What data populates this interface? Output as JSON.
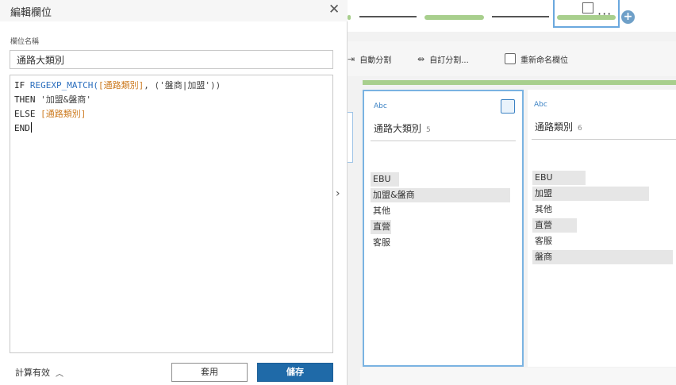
{
  "dialog": {
    "title": "編輯欄位",
    "field_label": "欄位名稱",
    "field_value": "通路大類別",
    "code_lines": [
      [
        {
          "t": "IF ",
          "c": "kw"
        },
        {
          "t": "REGEXP_MATCH(",
          "c": "fn"
        },
        {
          "t": "[通路類別]",
          "c": "fld"
        },
        {
          "t": ", ('盤商|加盟'))",
          "c": "str"
        }
      ],
      [
        {
          "t": "THEN ",
          "c": "kw"
        },
        {
          "t": "'加盟&盤商'",
          "c": "str"
        }
      ],
      [
        {
          "t": "ELSE ",
          "c": "kw"
        },
        {
          "t": "[通路類別]",
          "c": "fld"
        }
      ],
      [
        {
          "t": "END",
          "c": "kw"
        }
      ]
    ],
    "status": "計算有效",
    "apply_label": "套用",
    "save_label": "儲存"
  },
  "toolbar": {
    "auto_split": "自動分割",
    "custom_split": "自訂分割...",
    "rename": "重新命名欄位",
    "more": "···"
  },
  "columns": [
    {
      "type": "Abc",
      "name": "通路大類別",
      "count": "5",
      "selected": true,
      "values": [
        {
          "label": "EBU",
          "fraction": 0.2
        },
        {
          "label": "加盟&盤商",
          "fraction": 1.0
        },
        {
          "label": "其他",
          "fraction": 0.0
        },
        {
          "label": "直營",
          "fraction": 0.15
        },
        {
          "label": "客服",
          "fraction": 0.0
        }
      ]
    },
    {
      "type": "Abc",
      "name": "通路類別",
      "count": "6",
      "selected": false,
      "values": [
        {
          "label": "EBU",
          "fraction": 0.4
        },
        {
          "label": "加盟",
          "fraction": 1.0
        },
        {
          "label": "其他",
          "fraction": 0.0
        },
        {
          "label": "直營",
          "fraction": 0.3
        },
        {
          "label": "客服",
          "fraction": 0.0
        },
        {
          "label": "盤商",
          "fraction": 1.0
        }
      ]
    }
  ],
  "colors": {
    "accent": "#1f6aa8",
    "flow_green": "#a8cf8d",
    "selection_blue": "#7ab3e2",
    "field_orange": "#cc7a1f"
  }
}
